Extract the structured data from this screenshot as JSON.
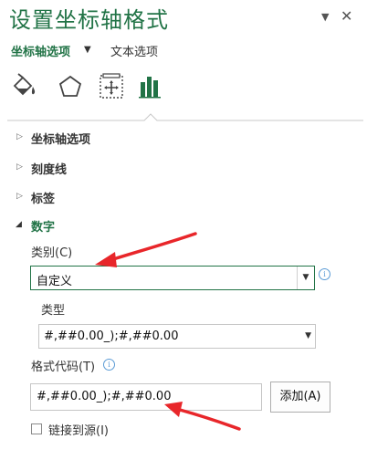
{
  "header": {
    "title": "设置坐标轴格式",
    "pin_glyph": "▼",
    "close_glyph": "✕"
  },
  "tabs": {
    "axis_options": "坐标轴选项",
    "axis_options_arrow": "▼",
    "text_options": "文本选项"
  },
  "toolbar_icons": [
    "fill-line-icon",
    "effects-icon",
    "size-properties-icon",
    "axis-options-icon"
  ],
  "sections": {
    "tick_marks_axis": "坐标轴选项",
    "tick_marks": "刻度线",
    "labels": "标签",
    "number": "数字"
  },
  "number": {
    "category_label": "类别(C)",
    "category_value": "自定义",
    "type_label": "类型",
    "type_value": "#,##0.00_);#,##0.00",
    "format_code_label": "格式代码(T)",
    "format_code_value": "#,##0.00_);#,##0.00",
    "add_button": "添加(A)",
    "link_to_source": "链接到源(I)",
    "link_to_source_checked": false
  },
  "info_glyph": "i",
  "colors": {
    "accent": "#217346",
    "annotation_red": "#e8262a"
  }
}
